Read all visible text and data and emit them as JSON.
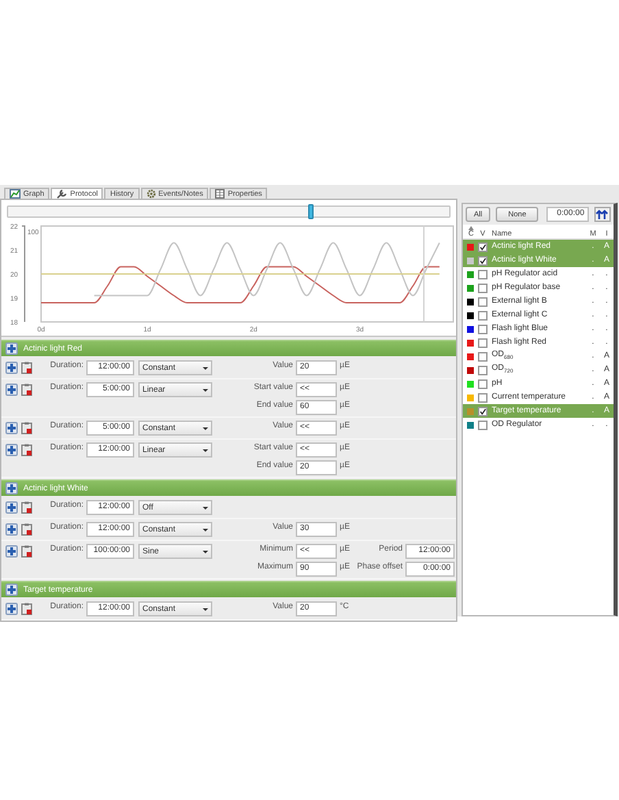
{
  "tabs": [
    {
      "label": "Graph",
      "selected": false
    },
    {
      "label": "Protocol",
      "selected": true
    },
    {
      "label": "History",
      "selected": false
    },
    {
      "label": "Events/Notes",
      "selected": false
    },
    {
      "label": "Properties",
      "selected": false
    }
  ],
  "timeline": {
    "level": 0.68
  },
  "graph": {
    "secondary_axis_label": "100",
    "chart_data": {
      "type": "line",
      "x": [
        0,
        0.125,
        0.25,
        0.375,
        0.5,
        0.625,
        0.75,
        0.875,
        1,
        1.125,
        1.25,
        1.375,
        1.5,
        1.625,
        1.75,
        1.875,
        2,
        2.125,
        2.25,
        2.375,
        2.5,
        2.625,
        2.75,
        2.875,
        3,
        3.125,
        3.25,
        3.375,
        3.5,
        3.625,
        3.75
      ],
      "series": [
        {
          "color": "#c8625e",
          "values": [
            18.8,
            18.8,
            18.8,
            18.8,
            18.8,
            19.5,
            20.3,
            20.3,
            19.9,
            19.5,
            19.1,
            18.8,
            18.8,
            18.8,
            18.8,
            18.8,
            19.5,
            20.3,
            20.3,
            20.3,
            19.9,
            19.5,
            19.1,
            18.8,
            18.8,
            18.8,
            18.8,
            18.8,
            19.5,
            20.3,
            20.3
          ]
        },
        {
          "color": "#c4c4c4",
          "values": [
            null,
            null,
            null,
            null,
            19.1,
            19.1,
            19.1,
            19.1,
            19.1,
            20.2,
            21.3,
            20.2,
            19.1,
            20.2,
            21.3,
            20.2,
            19.1,
            20.2,
            21.3,
            20.2,
            19.1,
            20.2,
            21.3,
            20.2,
            19.1,
            20.2,
            21.3,
            20.2,
            19.1,
            20.2,
            21.3
          ]
        },
        {
          "color": "#d9d08e",
          "values": [
            20,
            20,
            20,
            20,
            20,
            20,
            20,
            20,
            20,
            20,
            20,
            20,
            20,
            20,
            20,
            20,
            20,
            20,
            20,
            20,
            20,
            20,
            20,
            20,
            20,
            20,
            20,
            20,
            20,
            20,
            20
          ]
        }
      ],
      "xlim": [
        0,
        3.88
      ],
      "ylim": [
        18,
        22
      ],
      "yticks": [
        18,
        19,
        20,
        21,
        22
      ],
      "xticks": [
        {
          "value": 0,
          "label": "0d"
        },
        {
          "value": 1,
          "label": "1d"
        },
        {
          "value": 2,
          "label": "2d"
        },
        {
          "value": 3,
          "label": "3d"
        }
      ]
    }
  },
  "groups": [
    {
      "title": "Actinic light Red",
      "steps": [
        {
          "duration_label": "Duration:",
          "duration": "12:00:00",
          "mode": "Constant",
          "params": [
            [
              {
                "label": "Value",
                "value": "20",
                "unit": "µE"
              }
            ]
          ]
        },
        {
          "duration_label": "Duration:",
          "duration": "5:00:00",
          "mode": "Linear",
          "params": [
            [
              {
                "label": "Start value",
                "value": "<<",
                "unit": "µE"
              }
            ],
            [
              {
                "label": "End value",
                "value": "60",
                "unit": "µE"
              }
            ]
          ]
        },
        {
          "duration_label": "Duration:",
          "duration": "5:00:00",
          "mode": "Constant",
          "params": [
            [
              {
                "label": "Value",
                "value": "<<",
                "unit": "µE"
              }
            ]
          ]
        },
        {
          "duration_label": "Duration:",
          "duration": "12:00:00",
          "mode": "Linear",
          "params": [
            [
              {
                "label": "Start value",
                "value": "<<",
                "unit": "µE"
              }
            ],
            [
              {
                "label": "End value",
                "value": "20",
                "unit": "µE"
              }
            ]
          ]
        }
      ]
    },
    {
      "title": "Actinic light White",
      "steps": [
        {
          "duration_label": "Duration:",
          "duration": "12:00:00",
          "mode": "Off"
        },
        {
          "duration_label": "Duration:",
          "duration": "12:00:00",
          "mode": "Constant",
          "params": [
            [
              {
                "label": "Value",
                "value": "30",
                "unit": "µE"
              }
            ]
          ]
        },
        {
          "duration_label": "Duration:",
          "duration": "100:00:00",
          "mode": "Sine",
          "params": [
            [
              {
                "label": "Minimum",
                "value": "<<",
                "unit": "µE"
              },
              {
                "label": "Period",
                "value": "12:00:00"
              }
            ],
            [
              {
                "label": "Maximum",
                "value": "90",
                "unit": "µE"
              },
              {
                "label": "Phase offset",
                "value": "0:00:00"
              }
            ]
          ]
        }
      ]
    },
    {
      "title": "Target temperature",
      "steps": [
        {
          "duration_label": "Duration:",
          "duration": "12:00:00",
          "mode": "Constant",
          "params": [
            [
              {
                "label": "Value",
                "value": "20",
                "unit": "°C"
              }
            ]
          ]
        }
      ]
    }
  ],
  "channel_panel": {
    "buttons": [
      "All",
      "None"
    ],
    "time": "0:00:00",
    "columns": [
      "C",
      "V",
      "Name",
      "M",
      "I"
    ],
    "rows": [
      {
        "color": "#e81818",
        "visible": true,
        "name": "Actinic light Red",
        "m": ".",
        "i": "A",
        "selected": true
      },
      {
        "color": "#c8c8c8",
        "visible": true,
        "name": "Actinic light White",
        "m": ".",
        "i": "A",
        "selected": true
      },
      {
        "color": "#1ca21c",
        "visible": false,
        "name": "pH Regulator acid",
        "m": ".",
        "i": ".",
        "selected": false
      },
      {
        "color": "#1ca21c",
        "visible": false,
        "name": "pH Regulator base",
        "m": ".",
        "i": ".",
        "selected": false
      },
      {
        "color": "#000000",
        "visible": false,
        "name": "External light B",
        "m": ".",
        "i": ".",
        "selected": false
      },
      {
        "color": "#000000",
        "visible": false,
        "name": "External light C",
        "m": ".",
        "i": ".",
        "selected": false
      },
      {
        "color": "#1010e0",
        "visible": false,
        "name": "Flash light Blue",
        "m": ".",
        "i": ".",
        "selected": false
      },
      {
        "color": "#e81818",
        "visible": false,
        "name": "Flash light Red",
        "m": ".",
        "i": ".",
        "selected": false
      },
      {
        "color": "#e81818",
        "visible": false,
        "name": "OD$_{680}$",
        "m": ".",
        "i": "A",
        "selected": false
      },
      {
        "color": "#c00808",
        "visible": false,
        "name": "OD$_{720}$",
        "m": ".",
        "i": "A",
        "selected": false
      },
      {
        "color": "#20e020",
        "visible": false,
        "name": "pH",
        "m": ".",
        "i": "A",
        "selected": false
      },
      {
        "color": "#f8b800",
        "visible": false,
        "name": "Current temperature",
        "m": ".",
        "i": "A",
        "selected": false
      },
      {
        "color": "#b8902a",
        "visible": true,
        "name": "Target temperature",
        "m": ".",
        "i": "A",
        "selected": true
      },
      {
        "color": "#108088",
        "visible": false,
        "name": "OD Regulator",
        "m": ".",
        "i": ".",
        "selected": false
      }
    ]
  }
}
